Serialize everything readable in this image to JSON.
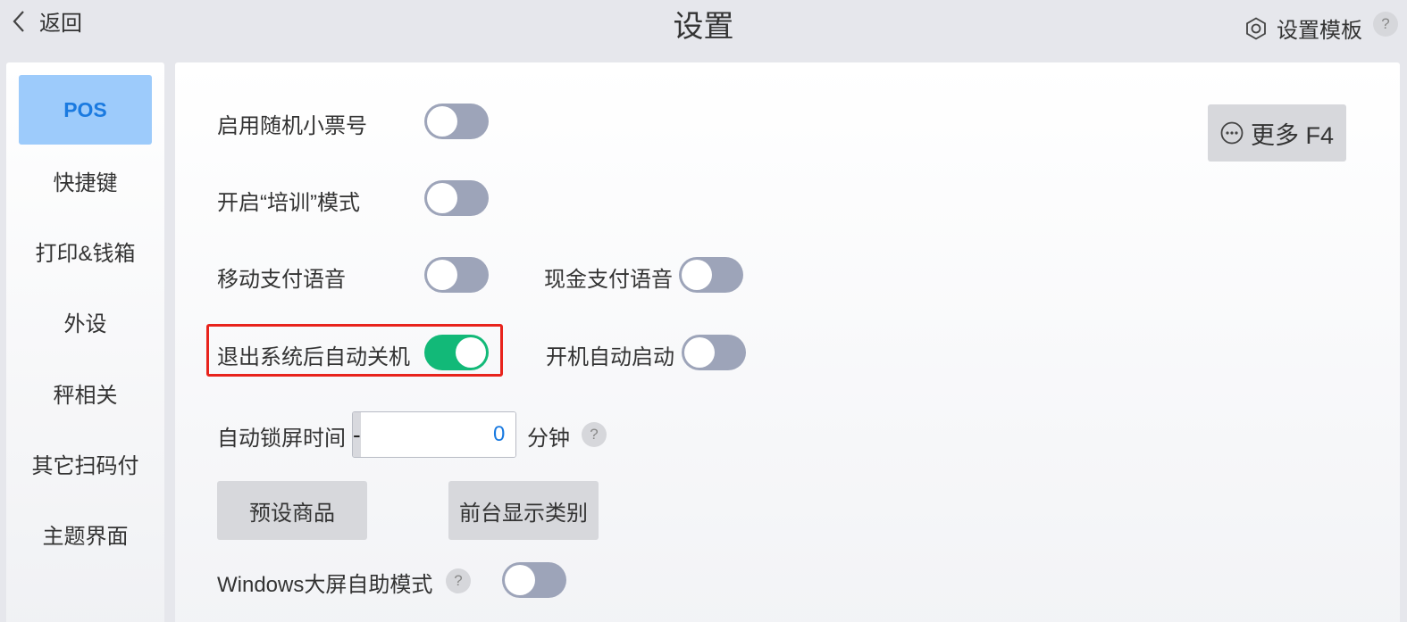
{
  "header": {
    "back_label": "返回",
    "title": "设置",
    "template_label": "设置模板",
    "help_glyph": "?"
  },
  "sidebar": {
    "items": [
      {
        "label": "POS",
        "active": true
      },
      {
        "label": "快捷键"
      },
      {
        "label": "打印&钱箱"
      },
      {
        "label": "外设"
      },
      {
        "label": "秤相关"
      },
      {
        "label": "其它扫码付"
      },
      {
        "label": "主题界面"
      }
    ]
  },
  "settings": {
    "random_receipt": {
      "label": "启用随机小票号",
      "on": false
    },
    "training_mode": {
      "label": "开启“培训”模式",
      "on": false
    },
    "mobile_pay_voice": {
      "label": "移动支付语音",
      "on": false
    },
    "cash_pay_voice": {
      "label": "现金支付语音",
      "on": false
    },
    "auto_shutdown": {
      "label": "退出系统后自动关机",
      "on": true
    },
    "auto_start": {
      "label": "开机自动启动",
      "on": false
    },
    "auto_lock": {
      "label": "自动锁屏时间",
      "value": "0",
      "minus": "-",
      "plus": "+",
      "unit": "分钟",
      "help": "?"
    },
    "preset_goods_label": "预设商品",
    "front_category_label": "前台显示类别",
    "windows_kiosk": {
      "label": "Windows大屏自助模式",
      "help": "?",
      "on": false
    }
  },
  "more_button": {
    "label": "更多 F4",
    "icon": "more-dots-icon"
  },
  "colors": {
    "accent": "#1a7ae0",
    "active_nav_bg": "#9dcbfb",
    "toggle_on": "#12b978",
    "toggle_off": "#9da4b9",
    "highlight": "#e8231c"
  }
}
